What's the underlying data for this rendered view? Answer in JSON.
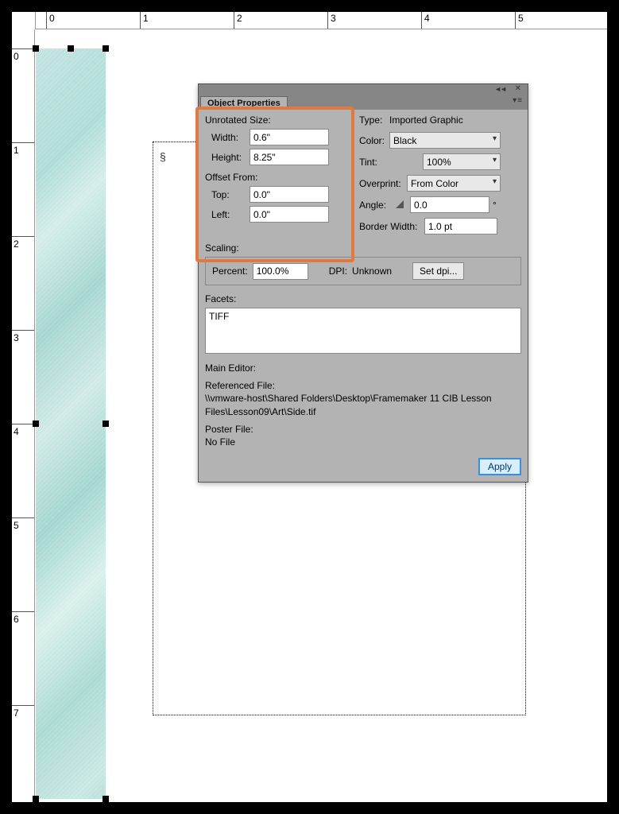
{
  "ruler": {
    "h_marks": [
      "0",
      "1",
      "2",
      "3",
      "4",
      "5"
    ],
    "v_marks": [
      "0",
      "1",
      "2",
      "3",
      "4",
      "5",
      "6",
      "7"
    ]
  },
  "textframe": {
    "section_mark": "§"
  },
  "panel": {
    "title": "Object Properties",
    "unrotated_label": "Unrotated Size:",
    "width_label": "Width:",
    "width_value": "0.6\"",
    "height_label": "Height:",
    "height_value": "8.25\"",
    "offset_label": "Offset From:",
    "top_label": "Top:",
    "top_value": "0.0\"",
    "left_label": "Left:",
    "left_value": "0.0\"",
    "type_label": "Type:",
    "type_value": "Imported Graphic",
    "color_label": "Color:",
    "color_value": "Black",
    "tint_label": "Tint:",
    "tint_value": "100%",
    "overprint_label": "Overprint:",
    "overprint_value": "From Color",
    "angle_label": "Angle:",
    "angle_value": "0.0",
    "angle_deg": "°",
    "border_label": "Border Width:",
    "border_value": "1.0 pt",
    "scaling_label": "Scaling:",
    "percent_label": "Percent:",
    "percent_value": "100.0%",
    "dpi_label": "DPI:",
    "dpi_value": "Unknown",
    "setdpi_label": "Set dpi...",
    "facets_label": "Facets:",
    "facets_value": "TIFF",
    "maineditor_label": "Main Editor:",
    "reffile_label": "Referenced File:",
    "reffile_value": "\\\\vmware-host\\Shared Folders\\Desktop\\Framemaker 11 CIB Lesson Files\\Lesson09\\Art\\Side.tif",
    "poster_label": "Poster File:",
    "poster_value": "No File",
    "apply_label": "Apply"
  }
}
